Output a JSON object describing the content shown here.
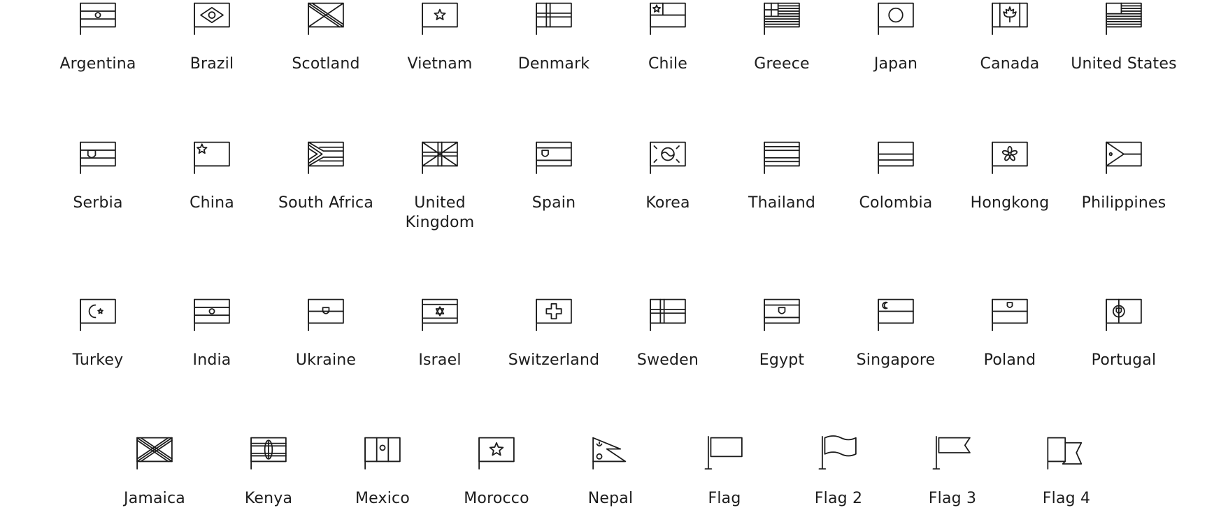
{
  "colors": {
    "stroke": "#1c1c1c",
    "text": "#1c1c1c",
    "background": "#ffffff"
  },
  "rows": [
    {
      "items": [
        {
          "label": "Argentina",
          "icon": "argentina-flag-icon",
          "draw": "argentina"
        },
        {
          "label": "Brazil",
          "icon": "brazil-flag-icon",
          "draw": "brazil"
        },
        {
          "label": "Scotland",
          "icon": "scotland-flag-icon",
          "draw": "scotland"
        },
        {
          "label": "Vietnam",
          "icon": "vietnam-flag-icon",
          "draw": "vietnam"
        },
        {
          "label": "Denmark",
          "icon": "denmark-flag-icon",
          "draw": "denmark"
        },
        {
          "label": "Chile",
          "icon": "chile-flag-icon",
          "draw": "chile"
        },
        {
          "label": "Greece",
          "icon": "greece-flag-icon",
          "draw": "greece"
        },
        {
          "label": "Japan",
          "icon": "japan-flag-icon",
          "draw": "japan"
        },
        {
          "label": "Canada",
          "icon": "canada-flag-icon",
          "draw": "canada"
        },
        {
          "label": "United States",
          "icon": "united-states-flag-icon",
          "draw": "usa"
        }
      ]
    },
    {
      "items": [
        {
          "label": "Serbia",
          "icon": "serbia-flag-icon",
          "draw": "serbia"
        },
        {
          "label": "China",
          "icon": "china-flag-icon",
          "draw": "china"
        },
        {
          "label": "South Africa",
          "icon": "south-africa-flag-icon",
          "draw": "southafrica"
        },
        {
          "label": "United Kingdom",
          "icon": "united-kingdom-flag-icon",
          "draw": "uk"
        },
        {
          "label": "Spain",
          "icon": "spain-flag-icon",
          "draw": "spain"
        },
        {
          "label": "Korea",
          "icon": "korea-flag-icon",
          "draw": "korea"
        },
        {
          "label": "Thailand",
          "icon": "thailand-flag-icon",
          "draw": "thailand"
        },
        {
          "label": "Colombia",
          "icon": "colombia-flag-icon",
          "draw": "colombia"
        },
        {
          "label": "Hongkong",
          "icon": "hongkong-flag-icon",
          "draw": "hongkong"
        },
        {
          "label": "Philippines",
          "icon": "philippines-flag-icon",
          "draw": "philippines"
        }
      ]
    },
    {
      "items": [
        {
          "label": "Turkey",
          "icon": "turkey-flag-icon",
          "draw": "turkey"
        },
        {
          "label": "India",
          "icon": "india-flag-icon",
          "draw": "india"
        },
        {
          "label": "Ukraine",
          "icon": "ukraine-flag-icon",
          "draw": "ukraine"
        },
        {
          "label": "Israel",
          "icon": "israel-flag-icon",
          "draw": "israel"
        },
        {
          "label": "Switzerland",
          "icon": "switzerland-flag-icon",
          "draw": "switzerland"
        },
        {
          "label": "Sweden",
          "icon": "sweden-flag-icon",
          "draw": "sweden"
        },
        {
          "label": "Egypt",
          "icon": "egypt-flag-icon",
          "draw": "egypt"
        },
        {
          "label": "Singapore",
          "icon": "singapore-flag-icon",
          "draw": "singapore"
        },
        {
          "label": "Poland",
          "icon": "poland-flag-icon",
          "draw": "poland"
        },
        {
          "label": "Portugal",
          "icon": "portugal-flag-icon",
          "draw": "portugal"
        }
      ]
    },
    {
      "items": [
        {
          "label": "Jamaica",
          "icon": "jamaica-flag-icon",
          "draw": "jamaica"
        },
        {
          "label": "Kenya",
          "icon": "kenya-flag-icon",
          "draw": "kenya"
        },
        {
          "label": "Mexico",
          "icon": "mexico-flag-icon",
          "draw": "mexico"
        },
        {
          "label": "Morocco",
          "icon": "morocco-flag-icon",
          "draw": "morocco"
        },
        {
          "label": "Nepal",
          "icon": "nepal-flag-icon",
          "draw": "nepal"
        },
        {
          "label": "Flag",
          "icon": "flag-icon",
          "draw": "flag1"
        },
        {
          "label": "Flag 2",
          "icon": "flag-wave-icon",
          "draw": "flag2"
        },
        {
          "label": "Flag 3",
          "icon": "flag-notched-icon",
          "draw": "flag3"
        },
        {
          "label": "Flag 4",
          "icon": "flag-folded-icon",
          "draw": "flag4"
        }
      ]
    }
  ]
}
